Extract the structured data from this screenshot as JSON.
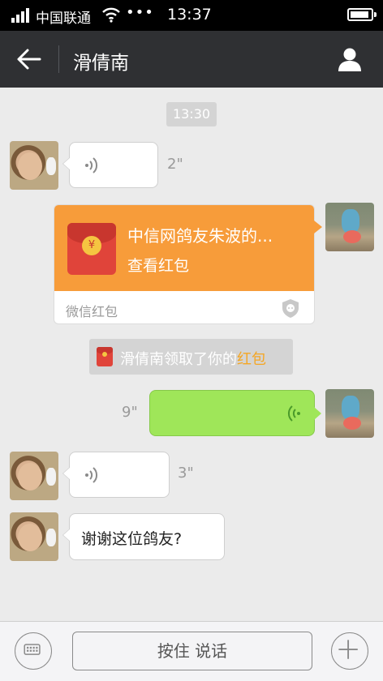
{
  "status_bar": {
    "carrier": "中国联通",
    "more": "•••",
    "time": "13:37"
  },
  "nav": {
    "title": "滑倩南",
    "back_icon": "back-arrow-icon",
    "profile_icon": "person-icon"
  },
  "chat": {
    "timestamp": "13:30",
    "messages": [
      {
        "type": "voice",
        "side": "left",
        "duration": "2\""
      },
      {
        "type": "red_packet",
        "side": "right",
        "title": "中信网鸽友朱波的...",
        "subtitle": "查看红包",
        "footer": "微信红包",
        "coin_symbol": "¥"
      },
      {
        "type": "system",
        "actor": "滑倩南领取了你的",
        "link": "红包"
      },
      {
        "type": "voice",
        "side": "right",
        "duration": "9\""
      },
      {
        "type": "voice",
        "side": "left",
        "duration": "3\""
      },
      {
        "type": "text",
        "side": "left",
        "text": "谢谢这位鸽友?"
      }
    ]
  },
  "input_bar": {
    "keyboard_icon": "keyboard-icon",
    "hold_to_talk": "按住 说话",
    "add_icon": "plus-icon"
  },
  "colors": {
    "nav_bg": "#2f3033",
    "chat_bg": "#ebebeb",
    "red_packet": "#f79c3a",
    "own_bubble": "#9fe659",
    "link_orange": "#f5a623"
  }
}
